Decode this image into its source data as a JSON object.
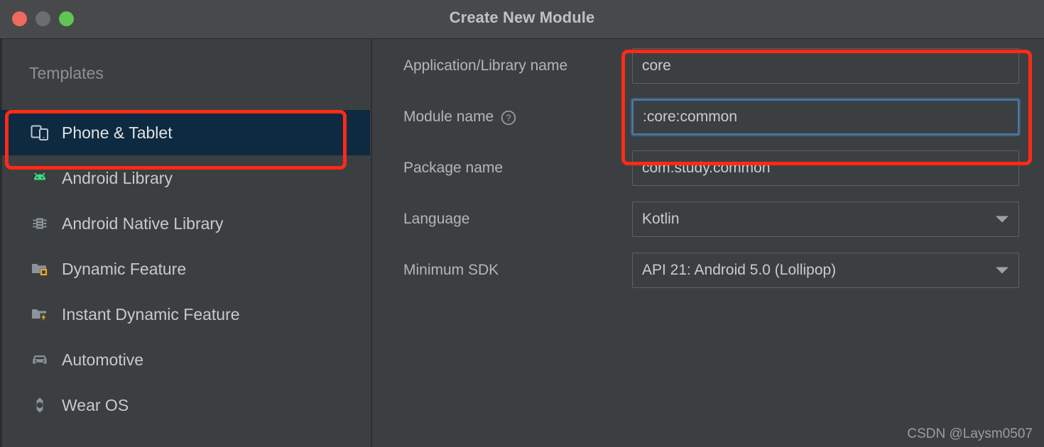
{
  "window": {
    "title": "Create New Module",
    "traffic_lights": [
      {
        "name": "close",
        "color": "#ec6a5e"
      },
      {
        "name": "minimize",
        "color": "#6b6d70"
      },
      {
        "name": "maximize",
        "color": "#61c555"
      }
    ]
  },
  "sidebar": {
    "header": "Templates",
    "items": [
      {
        "label": "Phone & Tablet",
        "icon": "phone-tablet-icon",
        "selected": true
      },
      {
        "label": "Android Library",
        "icon": "android-robot-icon",
        "selected": false
      },
      {
        "label": "Android Native Library",
        "icon": "chip-icon",
        "selected": false
      },
      {
        "label": "Dynamic Feature",
        "icon": "folder-dynamic-icon",
        "selected": false
      },
      {
        "label": "Instant Dynamic Feature",
        "icon": "folder-instant-icon",
        "selected": false
      },
      {
        "label": "Automotive",
        "icon": "car-icon",
        "selected": false
      },
      {
        "label": "Wear OS",
        "icon": "watch-icon",
        "selected": false
      }
    ]
  },
  "form": {
    "fields": [
      {
        "label": "Application/Library name",
        "type": "text",
        "value": "core",
        "placeholder": "",
        "focused": false,
        "help": false
      },
      {
        "label": "Module name",
        "type": "text",
        "value": ":core:common",
        "placeholder": "",
        "focused": true,
        "help": true,
        "help_icon": "question-circle-icon"
      },
      {
        "label": "Package name",
        "type": "text",
        "value": "com.study.common",
        "placeholder": "",
        "focused": false,
        "help": false
      },
      {
        "label": "Language",
        "type": "combo",
        "value": "Kotlin",
        "arrow_icon": "chevron-down-icon"
      },
      {
        "label": "Minimum SDK",
        "type": "combo",
        "value": "API 21: Android 5.0 (Lollipop)",
        "arrow_icon": "chevron-down-icon"
      }
    ]
  },
  "annotations": [
    {
      "name": "sidebar-highlight",
      "color": "#ff2a18"
    },
    {
      "name": "name-fields-highlight",
      "color": "#ff2a18"
    }
  ],
  "watermark": "CSDN @Laysm0507",
  "colors": {
    "window_chrome": "#48494b",
    "panel_bg": "#3c3f41",
    "selection_bg": "#0e2a40",
    "focus_border": "#4b7aab",
    "annotation_red": "#ff2a18",
    "android_green": "#3ddc84",
    "badge_orange": "#f5a623"
  }
}
